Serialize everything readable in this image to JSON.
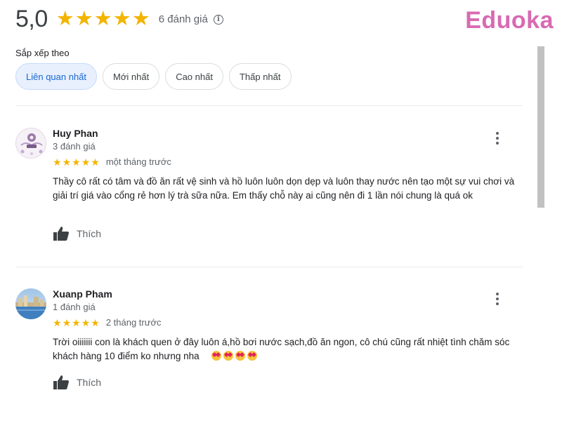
{
  "summary": {
    "rating": "5,0",
    "stars": 5,
    "count_text": "6 đánh giá",
    "info_glyph": "i"
  },
  "logo": {
    "text": "Eduoka",
    "color": "#d86ab2"
  },
  "sort": {
    "label": "Sắp xếp theo",
    "options": [
      {
        "label": "Liên quan nhất",
        "selected": true
      },
      {
        "label": "Mới nhất",
        "selected": false
      },
      {
        "label": "Cao nhất",
        "selected": false
      },
      {
        "label": "Thấp nhất",
        "selected": false
      }
    ]
  },
  "reviews": [
    {
      "name": "Huy Phan",
      "review_count": "3 đánh giá",
      "stars": 5,
      "time": "một tháng trước",
      "text": "Thầy cô rất có tâm và đồ ăn rất vệ sinh và hồ luôn luôn dọn dẹp và luôn thay nước nên tạo một sự vui chơi và giải trí giá vào cổng rẻ hơn lý trà sữa nữa. Em thấy chỗ này ai cũng nên đi 1 lần nói chung là quá ok",
      "like_label": "Thích",
      "avatar_icon": "avatar-huy-icon"
    },
    {
      "name": "Xuanp Pham",
      "review_count": "1 đánh giá",
      "stars": 5,
      "time": "2 tháng trước",
      "text": "Trời oiiiiiii con là khách quen ở đây luôn á,hồ bơi nước sạch,đồ ăn ngon, cô chú cũng rất nhiệt tình chăm sóc khách hàng 10 điểm ko nhưng nha",
      "emoji_count": 4,
      "like_label": "Thích",
      "avatar_icon": "avatar-landscape-icon"
    }
  ],
  "colors": {
    "star": "#f4b400",
    "chip_selected_bg": "#e8f0fe",
    "chip_selected_text": "#1967d2"
  },
  "icons": {
    "star": "★",
    "thumbs_up": "thumbs-up-icon",
    "more": "more-vert-icon",
    "info": "info-icon"
  }
}
